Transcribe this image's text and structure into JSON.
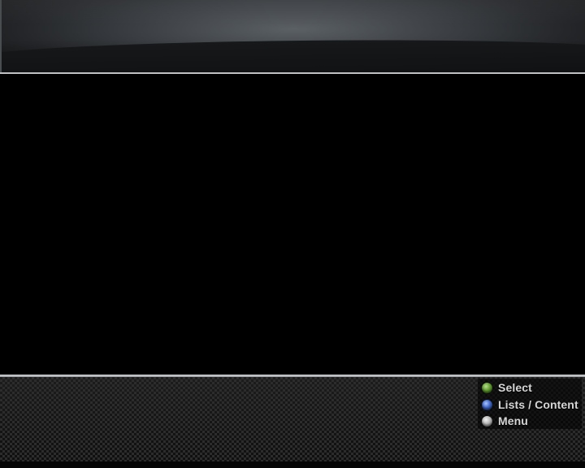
{
  "legend": {
    "items": [
      {
        "label": "Select",
        "icon": "green-button-icon",
        "color": "#5e9a2e"
      },
      {
        "label": "Lists / Content",
        "icon": "blue-button-icon",
        "color": "#3d64c4"
      },
      {
        "label": "Menu",
        "icon": "grey-button-icon",
        "color": "#b5b5b5"
      }
    ]
  },
  "theme": {
    "background": "#000000",
    "divider": "#bfc2c4",
    "label_color": "#d6d6d6"
  }
}
